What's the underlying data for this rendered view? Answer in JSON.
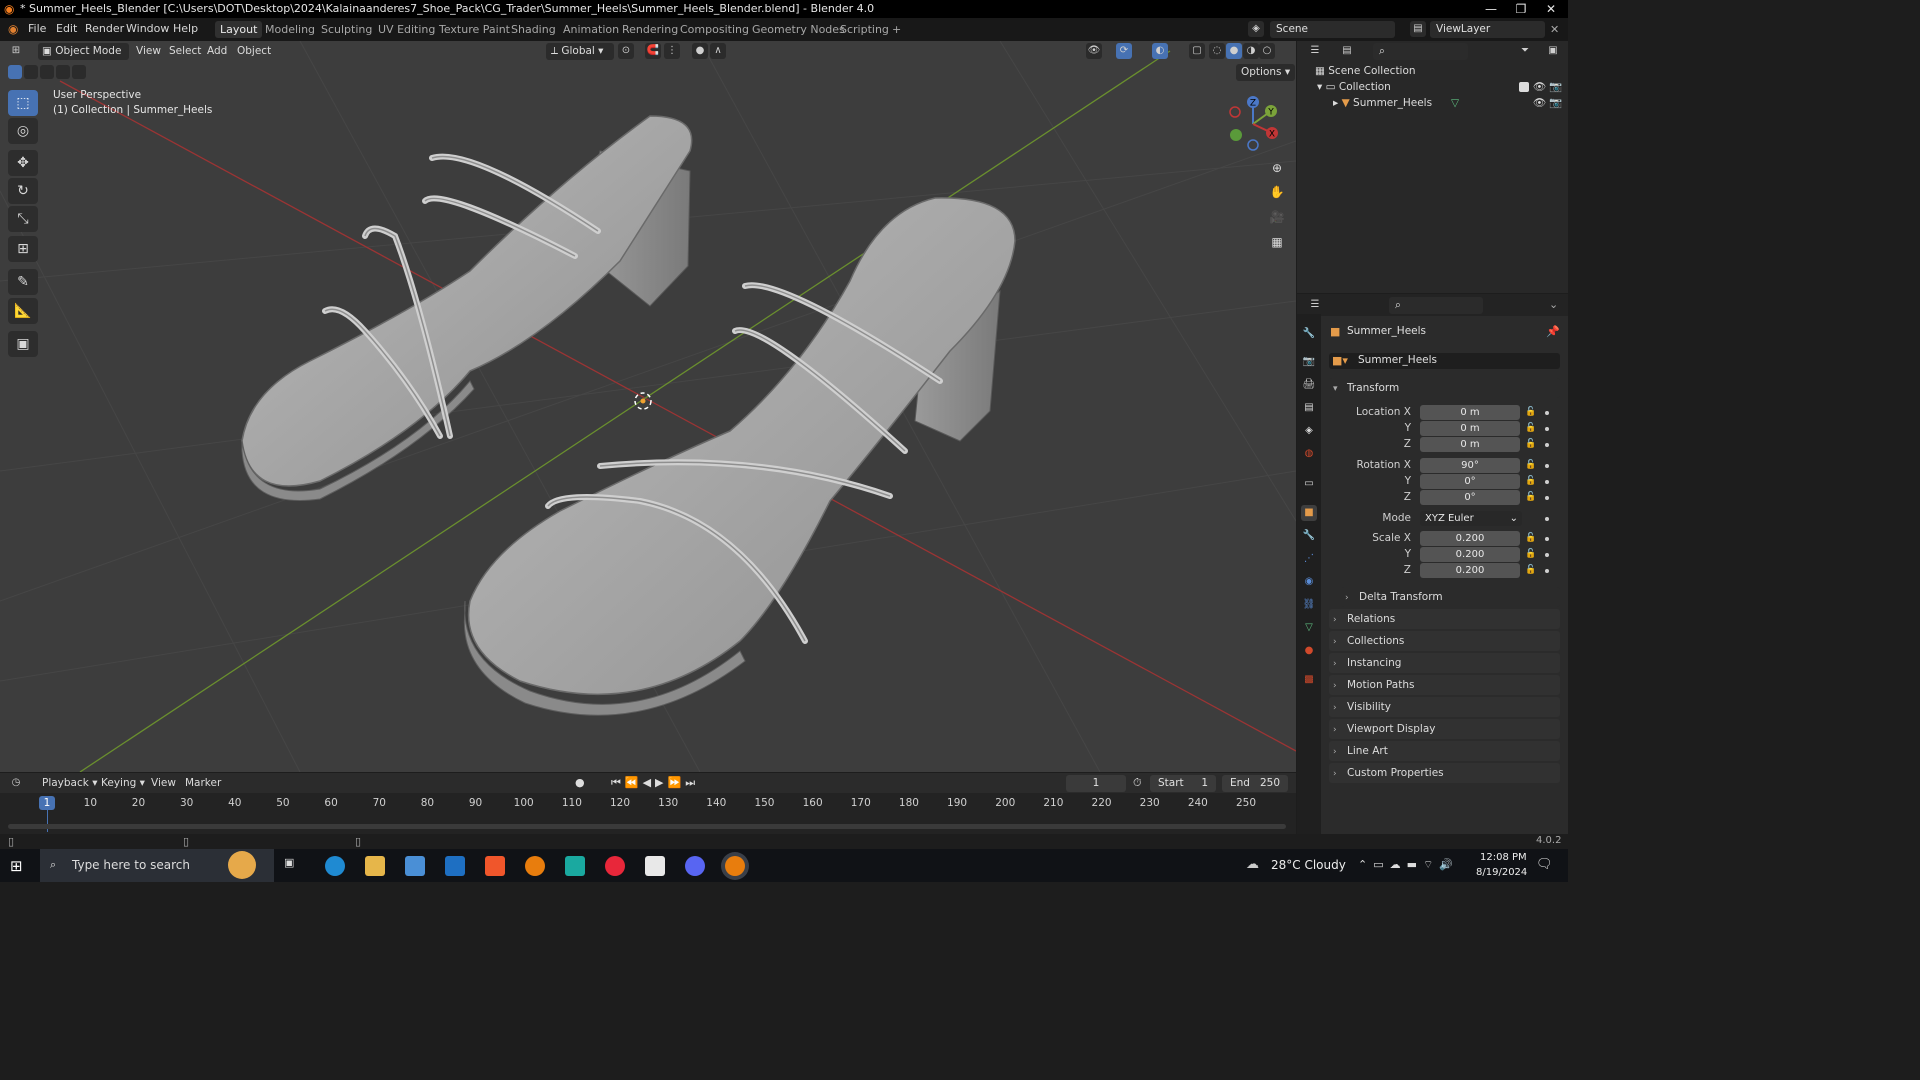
{
  "window": {
    "title": "* Summer_Heels_Blender [C:\\Users\\DOT\\Desktop\\2024\\Kalainaanderes7_Shoe_Pack\\CG_Trader\\Summer_Heels\\Summer_Heels_Blender.blend] - Blender 4.0",
    "minimize": "—",
    "restore": "❐",
    "close": "✕"
  },
  "menu": {
    "items": [
      "File",
      "Edit",
      "Render",
      "Window",
      "Help"
    ]
  },
  "workspaces": {
    "tabs": [
      "Layout",
      "Modeling",
      "Sculpting",
      "UV Editing",
      "Texture Paint",
      "Shading",
      "Animation",
      "Rendering",
      "Compositing",
      "Geometry Nodes",
      "Scripting"
    ],
    "add": "+",
    "active": "Layout"
  },
  "scene": {
    "name": "Scene",
    "view_layer": "ViewLayer"
  },
  "viewport_header": {
    "mode": "Object Mode",
    "menus": [
      "View",
      "Select",
      "Add",
      "Object"
    ],
    "orientation": "Global",
    "options": "Options"
  },
  "viewport": {
    "perspective": "User Perspective",
    "collection_info": "(1) Collection | Summer_Heels",
    "gizmo": {
      "z": "Z",
      "y": "Y",
      "x": "X"
    }
  },
  "outliner": {
    "scene_collection": "Scene Collection",
    "collection": "Collection",
    "object": "Summer_Heels"
  },
  "properties": {
    "object_name": "Summer_Heels",
    "data_name": "Summer_Heels",
    "transform_label": "Transform",
    "location": {
      "label_x": "Location X",
      "label_y": "Y",
      "label_z": "Z",
      "x": "0 m",
      "y": "0 m",
      "z": "0 m"
    },
    "rotation": {
      "label_x": "Rotation X",
      "label_y": "Y",
      "label_z": "Z",
      "x": "90°",
      "y": "0°",
      "z": "0°"
    },
    "mode": {
      "label": "Mode",
      "value": "XYZ Euler"
    },
    "scale": {
      "label_x": "Scale X",
      "label_y": "Y",
      "label_z": "Z",
      "x": "0.200",
      "y": "0.200",
      "z": "0.200"
    },
    "delta_transform": "Delta Transform",
    "panels": [
      "Relations",
      "Collections",
      "Instancing",
      "Motion Paths",
      "Visibility",
      "Viewport Display",
      "Line Art",
      "Custom Properties"
    ]
  },
  "timeline": {
    "menus": [
      "Playback",
      "Keying",
      "View",
      "Marker"
    ],
    "current_frame": "1",
    "start_label": "Start",
    "start": "1",
    "end_label": "End",
    "end": "250",
    "ticks": [
      "1",
      "10",
      "20",
      "30",
      "40",
      "50",
      "60",
      "70",
      "80",
      "90",
      "100",
      "110",
      "120",
      "130",
      "140",
      "150",
      "160",
      "170",
      "180",
      "190",
      "200",
      "210",
      "220",
      "230",
      "240",
      "250"
    ]
  },
  "status": {
    "version": "4.0.2"
  },
  "taskbar": {
    "search_placeholder": "Type here to search",
    "weather": "28°C  Cloudy",
    "time": "12:08 PM",
    "date": "8/19/2024"
  },
  "colors": {
    "accent": "#4772b3",
    "x_axis": "#c13636",
    "y_axis": "#7ba33a",
    "viewport_bg": "#3d3d3d"
  }
}
